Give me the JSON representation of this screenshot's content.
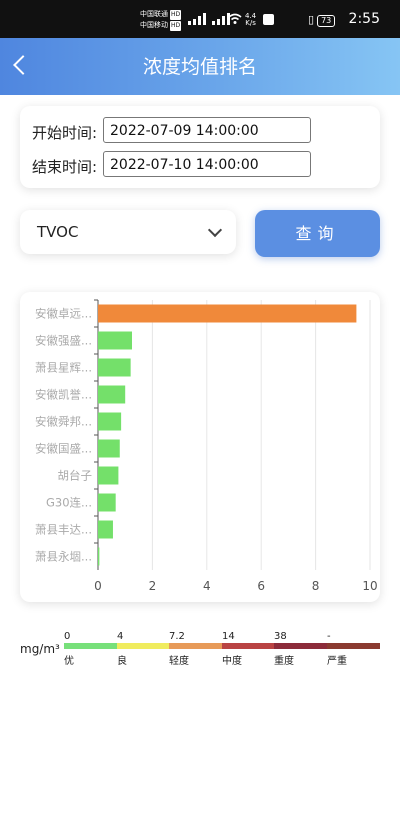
{
  "status_bar": {
    "carrier1": "中国联通",
    "carrier2": "中国移动",
    "hd": "HD",
    "network_speed": "4.4",
    "network_unit": "K/s",
    "battery": "73",
    "time": "2:55"
  },
  "header": {
    "title": "浓度均值排名"
  },
  "filters": {
    "start_label": "开始时间:",
    "start_value": "2022-07-09 14:00:00",
    "end_label": "结束时间:",
    "end_value": "2022-07-10 14:00:00",
    "pollutant": "TVOC",
    "query_label": "查询"
  },
  "chart_data": {
    "type": "bar",
    "orientation": "horizontal",
    "categories": [
      "安徽卓远...",
      "安徽强盛...",
      "萧县星辉...",
      "安徽凯誉...",
      "安徽舜邦...",
      "安徽国盛...",
      "胡台子",
      "G30连...",
      "萧县丰达...",
      "萧县永堌..."
    ],
    "values": [
      9.5,
      1.25,
      1.2,
      1.0,
      0.85,
      0.8,
      0.75,
      0.65,
      0.55,
      0.05
    ],
    "colors": [
      "#f0893a",
      "#74e06a",
      "#74e06a",
      "#74e06a",
      "#74e06a",
      "#74e06a",
      "#74e06a",
      "#74e06a",
      "#74e06a",
      "#74e06a"
    ],
    "xticks": [
      "0",
      "2",
      "4",
      "6",
      "8",
      "10"
    ],
    "xlim": [
      0,
      10
    ],
    "grid": "vertical"
  },
  "legend": {
    "unit": "mg/m³",
    "values": [
      "0",
      "4",
      "7.2",
      "14",
      "38",
      "-"
    ],
    "names": [
      "优",
      "良",
      "轻度",
      "中度",
      "重度",
      "严重"
    ],
    "colors": [
      "#77e07a",
      "#f0ec5e",
      "#e79a58",
      "#b94343",
      "#8c2b3a",
      "#8a3a30"
    ]
  }
}
